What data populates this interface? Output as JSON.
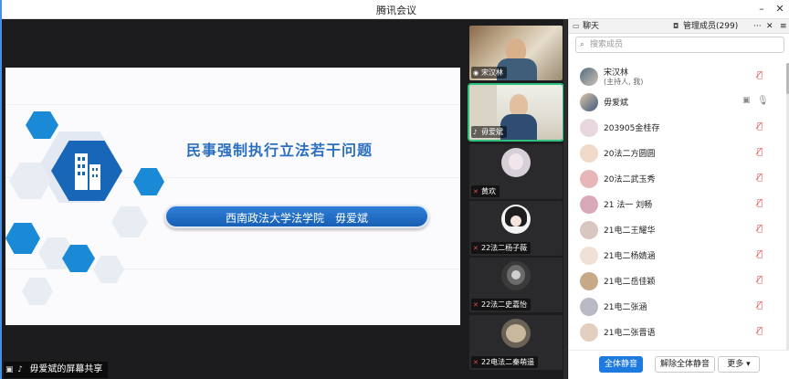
{
  "window": {
    "title": "腾讯会议"
  },
  "share": {
    "slide_title": "民事强制执行立法若干问题",
    "slide_subtitle": "西南政法大学法学院　毋爱斌",
    "label": "毋爱斌的屏幕共享"
  },
  "videos": [
    {
      "name": "宋汉林",
      "muted": false,
      "kind": "camera"
    },
    {
      "name": "毋爱斌",
      "muted": false,
      "kind": "camera",
      "active": true
    },
    {
      "name": "黄欢",
      "muted": true,
      "kind": "avatar"
    },
    {
      "name": "22法二杨子薇",
      "muted": true,
      "kind": "avatar"
    },
    {
      "name": "22法二史嘉怡",
      "muted": true,
      "kind": "avatar"
    },
    {
      "name": "22电法二秦萌遥",
      "muted": true,
      "kind": "avatar"
    }
  ],
  "panel": {
    "tab_chat": "聊天",
    "tab_members": "管理成员(299)",
    "more_icon": "···",
    "search_placeholder": "搜索成员",
    "members": [
      {
        "name": "宋汉林",
        "sub": "(主持人, 我)",
        "mic": "muted"
      },
      {
        "name": "毋爱斌",
        "sub": "",
        "mic": "on",
        "cam": true
      },
      {
        "name": "203905金桂存",
        "sub": "",
        "mic": "muted"
      },
      {
        "name": "20法二方圆圆",
        "sub": "",
        "mic": "muted"
      },
      {
        "name": "20法二武玉秀",
        "sub": "",
        "mic": "muted"
      },
      {
        "name": "21 法一 刘畅",
        "sub": "",
        "mic": "muted"
      },
      {
        "name": "21电二王耀华",
        "sub": "",
        "mic": "muted"
      },
      {
        "name": "21电二杨婧涵",
        "sub": "",
        "mic": "muted"
      },
      {
        "name": "21电二岳佳颖",
        "sub": "",
        "mic": "muted"
      },
      {
        "name": "21电二张涵",
        "sub": "",
        "mic": "muted"
      },
      {
        "name": "21电二张晋语",
        "sub": "",
        "mic": "muted"
      }
    ],
    "btn_mute_all": "全体静音",
    "btn_unmute_all": "解除全体静音",
    "btn_more": "更多 ▾"
  },
  "colors": {
    "accent": "#1f7ae0",
    "slide_blue": "#2b6fc0",
    "muted_red": "#e05050"
  }
}
